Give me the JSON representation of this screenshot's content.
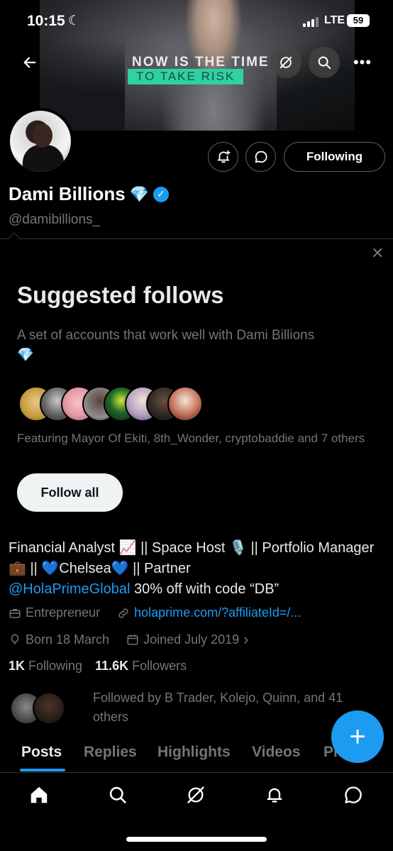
{
  "status_bar": {
    "time": "10:15",
    "network": "LTE",
    "battery": "59"
  },
  "banner": {
    "line1": "NOW IS THE TIME",
    "line2": "TO TAKE RISK"
  },
  "header": {
    "more_label": "•••"
  },
  "profile": {
    "name": "Dami Billions",
    "name_emoji": "💎",
    "handle": "@damibillions_",
    "following_button": "Following"
  },
  "suggested": {
    "close_label": "✕",
    "title": "Suggested follows",
    "description": "A set of accounts that work well with Dami Billions",
    "description_emoji": "💎",
    "featuring": "Featuring Mayor Of Ekiti, 8th_Wonder, cryptobaddie and 7 others",
    "follow_all": "Follow all"
  },
  "bio": {
    "line1": "Financial Analyst 📈 || Space Host 🎙️ || Portfolio Manager💼 || 💙Chelsea💙 || Partner",
    "mention": "@HolaPrimeGlobal",
    "line2": " 30% off with code “DB”"
  },
  "meta": {
    "category": "Entrepreneur",
    "website": "holaprime.com/?affiliateId=/...",
    "born": "Born 18 March",
    "joined": "Joined July 2019",
    "joined_chevron": "›"
  },
  "counts": {
    "following_count": "1K",
    "following_label": "Following",
    "followers_count": "11.6K",
    "followers_label": "Followers"
  },
  "followed_by": "Followed by B Trader, Kolejo, Quinn, and 41 others",
  "tabs": [
    "Posts",
    "Replies",
    "Highlights",
    "Videos",
    "Ph"
  ],
  "fab_label": "+",
  "colors": {
    "accent": "#1d9bf0",
    "background": "#000000",
    "muted": "#71767b"
  }
}
